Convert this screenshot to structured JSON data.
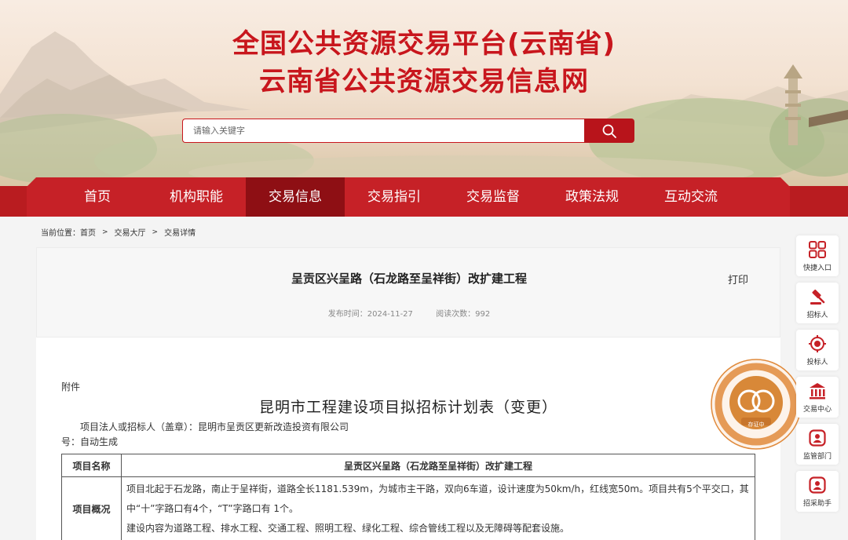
{
  "header": {
    "title_line1": "全国公共资源交易平台(云南省)",
    "title_line2": "云南省公共资源交易信息网"
  },
  "search": {
    "placeholder": "请输入关键字"
  },
  "nav": {
    "items": [
      {
        "label": "首页"
      },
      {
        "label": "机构职能"
      },
      {
        "label": "交易信息"
      },
      {
        "label": "交易指引"
      },
      {
        "label": "交易监督"
      },
      {
        "label": "政策法规"
      },
      {
        "label": "互动交流"
      }
    ],
    "active_index": 2
  },
  "breadcrumb": {
    "prefix": "当前位置：",
    "items": [
      "首页",
      "交易大厅",
      "交易详情"
    ],
    "separator": ">"
  },
  "article": {
    "title": "呈贡区兴呈路（石龙路至呈祥街）改扩建工程",
    "print_label": "打印",
    "publish_time": "发布时间：2024-11-27",
    "views": "阅读次数：992"
  },
  "document": {
    "attachment_label": "附件",
    "title": "昆明市工程建设项目拟招标计划表（变更）",
    "owner_line": "项目法人或招标人（盖章）：昆明市呈贡区更新改造投资有限公司",
    "number_line": "号：自动生成",
    "table": [
      {
        "key": "项目名称",
        "value": "呈贡区兴呈路（石龙路至呈祥街）改扩建工程"
      },
      {
        "key": "项目概况",
        "value": "项目北起于石龙路，南止于呈祥街，道路全长1181.539m，为城市主干路，双向6车道，设计速度为50km/h，红线宽50m。项目共有5个平交口，其中“十”字路口有4个，“T”字路口有 1个。",
        "value2": "建设内容为道路工程、排水工程、交通工程、照明工程、绿化工程、综合管线工程以及无障碍等配套设施。"
      }
    ]
  },
  "sidebar": {
    "items": [
      {
        "label": "快捷入口",
        "icon": "grid-icon"
      },
      {
        "label": "招标人",
        "icon": "gavel-icon"
      },
      {
        "label": "投标人",
        "icon": "target-icon"
      },
      {
        "label": "交易中心",
        "icon": "building-icon"
      },
      {
        "label": "监管部门",
        "icon": "shield-icon"
      },
      {
        "label": "招采助手",
        "icon": "assistant-icon"
      }
    ]
  },
  "seal": {
    "label": "存证中"
  },
  "colors": {
    "brand_red": "#c62127",
    "nav_active": "#8e0f14",
    "seal_orange": "#e08a3c"
  }
}
